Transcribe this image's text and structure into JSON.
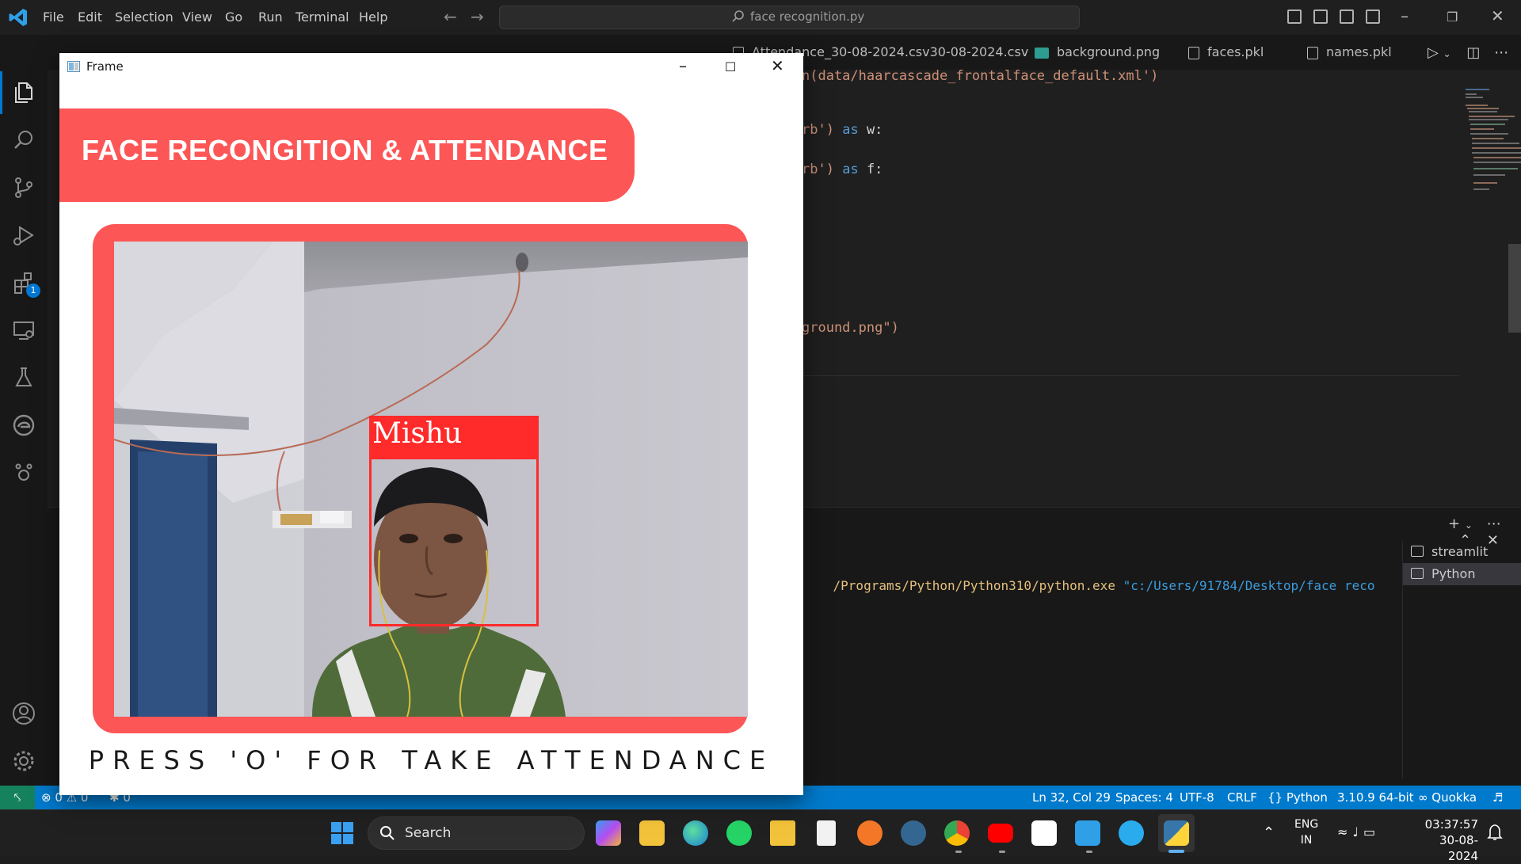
{
  "titlebar": {
    "menu": [
      "File",
      "Edit",
      "Selection",
      "View",
      "Go",
      "Run",
      "Terminal",
      "Help"
    ],
    "search_text": "face recognition.py"
  },
  "tabs": {
    "items": [
      "Attendance_30-08-2024.csv30-08-2024.csv",
      "background.png",
      "faces.pkl",
      "names.pkl"
    ]
  },
  "activitybar": {
    "extensions_badge": "1"
  },
  "editor": {
    "line1": "n(data/haarcascade_frontalface_default.xml')",
    "line2_str": "rb')",
    "line2_kw": "as",
    "line2_var": "w:",
    "line3_str": "rb')",
    "line3_kw": "as",
    "line3_var": "f:",
    "line4": "ground.png\")"
  },
  "panel": {
    "terminal_path": "/Programs/Python/Python310/python.exe",
    "terminal_arg": "\"c:/Users/91784/Desktop/face reco",
    "terminals": [
      "streamlit",
      "Python"
    ]
  },
  "statusbar": {
    "errors": "0",
    "warnings": "0",
    "ports": "0",
    "cursor": "Ln 32, Col 29",
    "spaces": "Spaces: 4",
    "encoding": "UTF-8",
    "eol": "CRLF",
    "language": "Python",
    "interpreter": "3.10.9 64-bit",
    "quokka": "Quokka"
  },
  "taskbar": {
    "search_label": "Search",
    "lang_top": "ENG",
    "lang_bottom": "IN",
    "time": "03:37:57",
    "date": "30-08-2024"
  },
  "frame": {
    "title": "Frame",
    "banner": "FACE RECONGITION & ATTENDANCE",
    "name_label": "Mishu",
    "press_text": "PRESS 'O' FOR TAKE ATTENDANCE"
  },
  "colors": {
    "accent_red": "#fd5656",
    "status_blue": "#007acc",
    "remote_green": "#16825d"
  }
}
